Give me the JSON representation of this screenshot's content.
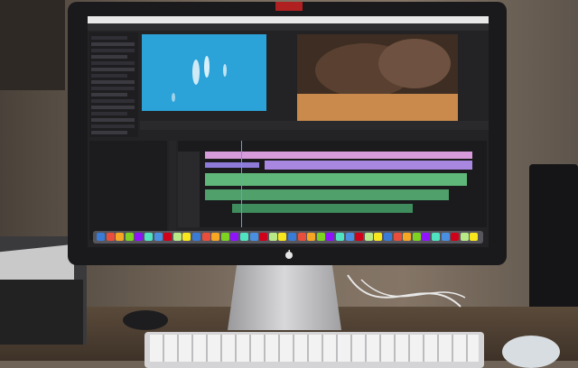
{
  "scene": {
    "description_tags": [
      "monitor-icon",
      "keyboard-icon",
      "mouse-icon",
      "printer-icon",
      "speaker-icon"
    ],
    "colors": {
      "source_monitor": "#2ba3d8",
      "program_monitor": "#3e2d22",
      "audio_clip": "#5fb87a",
      "video_clip_pink": "#d79adb",
      "video_clip_purple": "#8e7bd8",
      "playhead": "#4ea4ff"
    }
  },
  "app": {
    "menu": [
      "",
      "",
      "",
      "",
      "",
      "",
      "",
      "",
      ""
    ],
    "workspaces": [
      "",
      "",
      "",
      "",
      "",
      "",
      ""
    ]
  }
}
